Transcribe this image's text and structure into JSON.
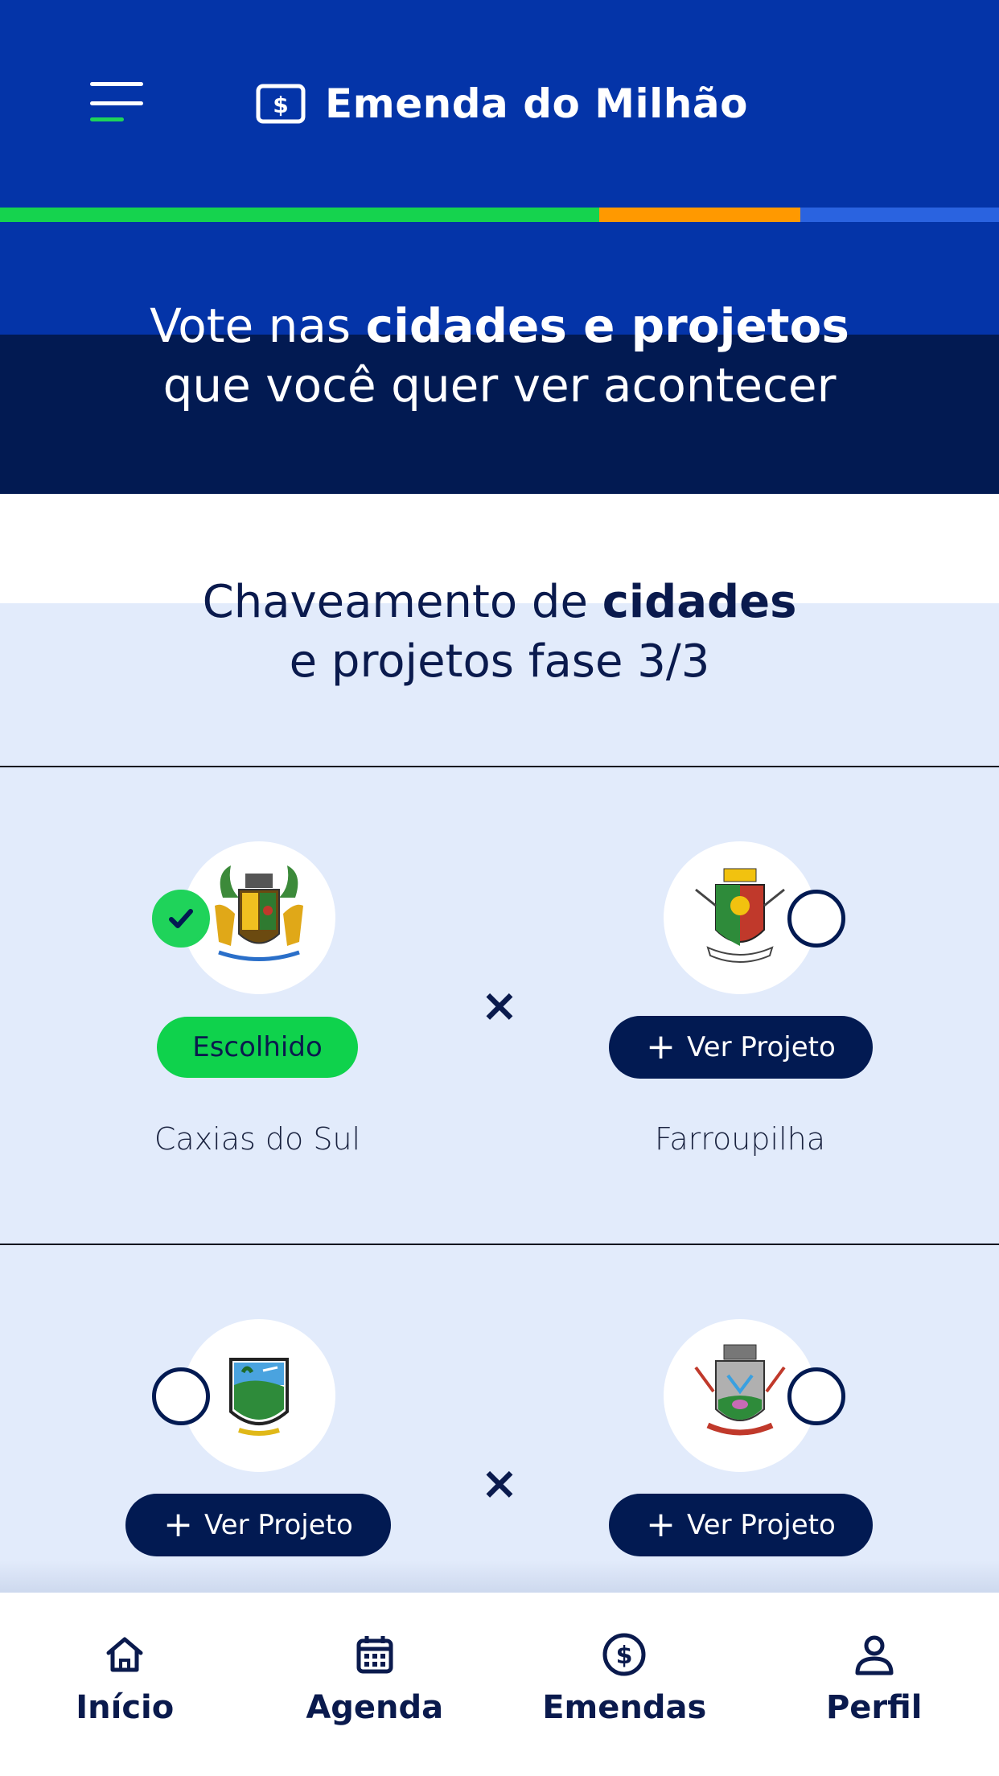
{
  "header": {
    "title": "Emenda do Milhão",
    "menu_icon": "hamburger-menu-icon",
    "brand_icon": "dollar-bill-icon",
    "progress_colors": [
      "#15d34e",
      "#ff9900",
      "#2a63e0"
    ]
  },
  "hero": {
    "line1_pre": "Vote nas ",
    "line1_bold": "cidades e projetos",
    "line2": "que você quer ver acontecer"
  },
  "section": {
    "title_pre": "Chaveamento de ",
    "title_bold": "cidades",
    "title_line2": "e projetos fase 3/3"
  },
  "matches": [
    {
      "vs": "×",
      "left": {
        "city": "Caxias do Sul",
        "selected": true,
        "chip": "Escolhido"
      },
      "right": {
        "city": "Farroupilha",
        "selected": false,
        "button": "Ver Projeto"
      }
    },
    {
      "vs": "×",
      "left": {
        "selected": false,
        "button": "Ver Projeto"
      },
      "right": {
        "selected": false,
        "button": "Ver Projeto"
      }
    }
  ],
  "bottom_nav": [
    {
      "label": "Início",
      "icon": "home-icon"
    },
    {
      "label": "Agenda",
      "icon": "calendar-icon"
    },
    {
      "label": "Emendas",
      "icon": "dollar-circle-icon"
    },
    {
      "label": "Perfil",
      "icon": "user-icon"
    }
  ],
  "colors": {
    "primary_blue": "#0434a8",
    "dark_navy": "#021a52",
    "accent_green": "#1fd35a",
    "section_bg": "#e2ebfb"
  }
}
